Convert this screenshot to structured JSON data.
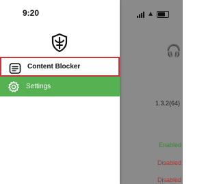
{
  "status_bar": {
    "time": "9:20"
  },
  "drawer": {
    "items": [
      {
        "label": "Content Blocker",
        "icon": "list-document-icon"
      },
      {
        "label": "Settings",
        "icon": "gear-icon"
      }
    ]
  },
  "background": {
    "version": "1.3.2(64)",
    "statuses": [
      "Enabled",
      "Disabled",
      "Disabled"
    ]
  },
  "colors": {
    "accent_green": "#55b152",
    "highlight_red": "#c9353d",
    "enabled_text": "#2e8a2e",
    "disabled_text": "#b33030"
  }
}
